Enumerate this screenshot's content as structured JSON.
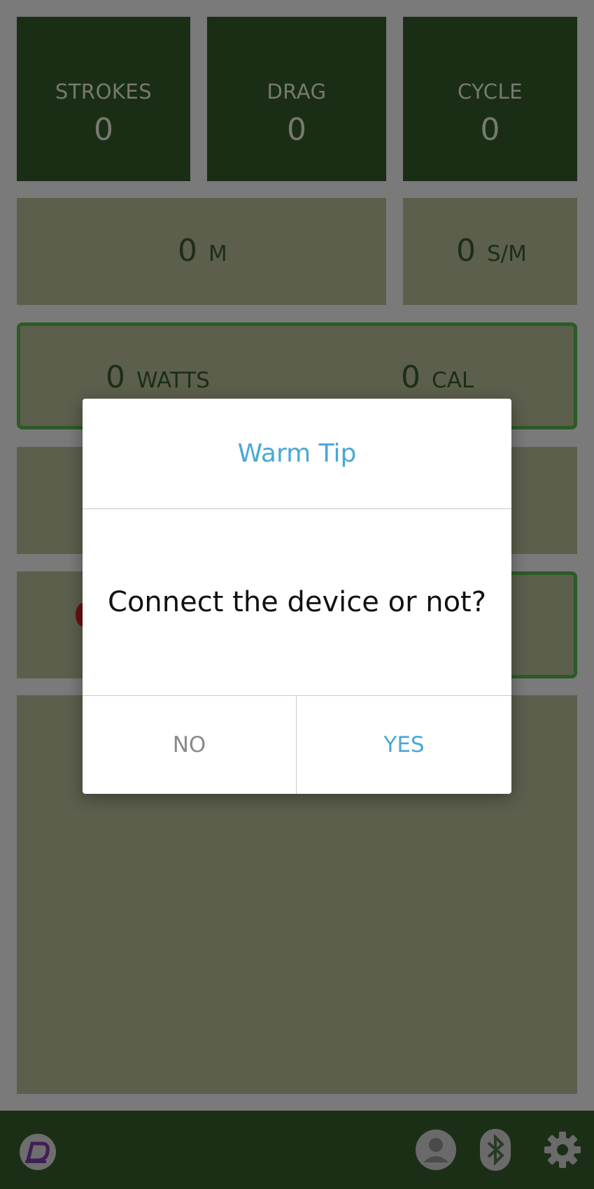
{
  "stats": [
    {
      "label": "STROKES",
      "value": "0"
    },
    {
      "label": "DRAG",
      "value": "0"
    },
    {
      "label": "CYCLE",
      "value": "0"
    }
  ],
  "distance": {
    "value": "0",
    "unit": "M"
  },
  "rate": {
    "value": "0",
    "unit": "S/M"
  },
  "power": {
    "value": "0",
    "unit": "WATTS"
  },
  "calories": {
    "value": "0",
    "unit": "CAL"
  },
  "dialog": {
    "title": "Warm Tip",
    "message": "Connect the device or not?",
    "no_label": "NO",
    "yes_label": "YES"
  },
  "bottom_bar": {
    "icons": [
      "app-logo-icon",
      "profile-icon",
      "bluetooth-icon",
      "settings-gear-icon"
    ]
  },
  "colors": {
    "accent": "#49a8d6",
    "tile_dark": "#1a2e15",
    "tile_light": "#5c5f4c",
    "bar": "#1b2f16"
  }
}
